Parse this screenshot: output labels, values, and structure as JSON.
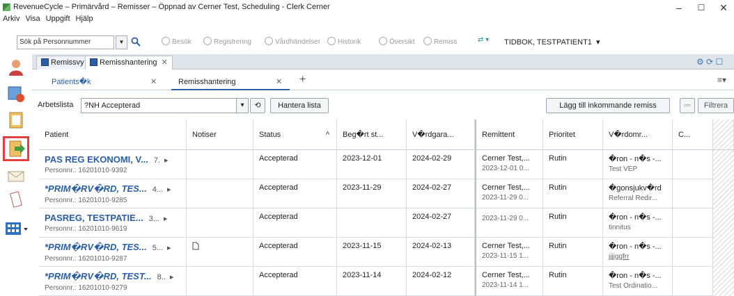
{
  "window": {
    "title": "RevenueCycle – Primärvård – Remisser – Öppnad av Cerner Test, Scheduling - Clerk Cerner",
    "controls": {
      "minimize": "–",
      "maximize": "☐",
      "close": "✕"
    }
  },
  "menu": [
    "Arkiv",
    "Visa",
    "Uppgift",
    "Hjälp"
  ],
  "toolbar": {
    "search_value": "Sök på Personnummer",
    "items": [
      "Besök",
      "Registrering",
      "Vårdhändelser",
      "Historik",
      "Översikt",
      "Remiss"
    ],
    "patient": "TIDBOK, TESTPATIENT1"
  },
  "doc_tabs": [
    "Remissvy",
    "Remisshantering"
  ],
  "sub_tabs": [
    "Patients�k",
    "Remisshantering"
  ],
  "filter": {
    "label": "Arbetslista",
    "value": "?NH Accepterad",
    "manage_button": "Hantera lista",
    "add_button": "Lägg till inkommande remiss",
    "filter_button": "Filtrera"
  },
  "grid": {
    "columns": [
      "Patient",
      "Notiser",
      "Status",
      "Beg�rt st...",
      "V�rdgara...",
      "Remittent",
      "Prioritet",
      "V�rdomr...",
      "C..."
    ],
    "rows": [
      {
        "name": "PAS REG EKONOMI, V...",
        "extra": "7.",
        "pnr": "Personnr.: 16201010-9392",
        "note": "",
        "status": "Accepterad",
        "begart": "2023-12-01",
        "vardgar": "2024-02-29",
        "rem1": "Cerner Test,...",
        "rem2": "2023-12-01 0...",
        "prio": "Rutin",
        "vo1": "�ron - n�s -...",
        "vo2": "Test VEP",
        "italic": false
      },
      {
        "name": "*PRIM�RV�RD, TES...",
        "extra": "4...",
        "pnr": "Personnr.: 16201010-9285",
        "note": "",
        "status": "Accepterad",
        "begart": "2023-11-29",
        "vardgar": "2024-02-27",
        "rem1": "Cerner Test,...",
        "rem2": "2023-11-29 0...",
        "prio": "Rutin",
        "vo1": "�gonsjukv�rd",
        "vo2": "Referral Redir...",
        "italic": true
      },
      {
        "name": "PASREG, TESTPATIE...",
        "extra": "3...",
        "pnr": "Personnr.: 16201010-9619",
        "note": "",
        "status": "Accepterad",
        "begart": "",
        "vardgar": "2024-02-27",
        "rem1": "",
        "rem2": "2023-11-29 0...",
        "prio": "Rutin",
        "vo1": "�ron - n�s -...",
        "vo2": "tinnitus",
        "italic": false
      },
      {
        "name": "*PRIM�RV�RD, TES...",
        "extra": "5...",
        "pnr": "Personnr.: 16201010-9287",
        "note": "doc",
        "status": "Accepterad",
        "begart": "2023-11-15",
        "vardgar": "2024-02-13",
        "rem1": "Cerner Test,...",
        "rem2": "2023-11-15 1...",
        "prio": "Rutin",
        "vo1": "�ron - n�s -...",
        "vo2": "jjjjggfrr",
        "italic": true
      },
      {
        "name": "*PRIM�RV�RD, TEST...",
        "extra": "8..",
        "pnr": "Personnr.: 16201010-9279",
        "note": "",
        "status": "Accepterad",
        "begart": "2023-11-14",
        "vardgar": "2024-02-12",
        "rem1": "Cerner Test,...",
        "rem2": "2023-11-14 1...",
        "prio": "Rutin",
        "vo1": "�ron - n�s -...",
        "vo2": "Test Ordinatio...",
        "italic": true
      }
    ]
  },
  "colors": {
    "accent": "#2a5ea8",
    "highlight_border": "#e04040"
  }
}
